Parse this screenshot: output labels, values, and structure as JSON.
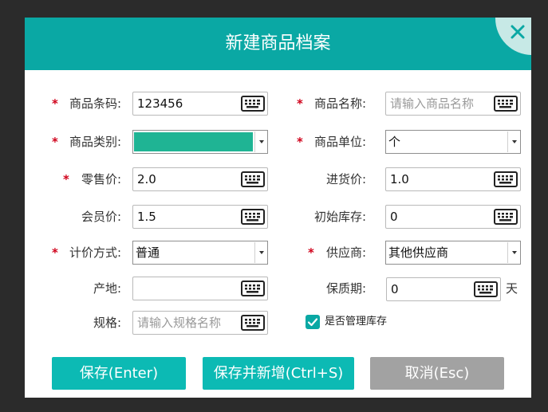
{
  "dialog": {
    "title": "新建商品档案",
    "close_icon": "close-icon",
    "accent_color": "#0aa8a4"
  },
  "required_mark": "*",
  "form": {
    "barcode": {
      "label": "商品条码:",
      "value": "123456",
      "required": true
    },
    "name": {
      "label": "商品名称:",
      "placeholder": "请输入商品名称",
      "required": true
    },
    "category": {
      "label": "商品类别:",
      "selected_color": "#1fb494",
      "required": true
    },
    "unit": {
      "label": "商品单位:",
      "value": "个",
      "required": true
    },
    "retail": {
      "label": "零售价:",
      "value": "2.0",
      "required": true
    },
    "purchase": {
      "label": "进货价:",
      "value": "1.0",
      "required": false
    },
    "member": {
      "label": "会员价:",
      "value": "1.5",
      "required": false
    },
    "stock": {
      "label": "初始库存:",
      "value": "0",
      "required": false
    },
    "pricing": {
      "label": "计价方式:",
      "value": "普通",
      "required": true
    },
    "supplier": {
      "label": "供应商:",
      "value": "其他供应商",
      "required": true
    },
    "origin": {
      "label": "产地:",
      "value": "",
      "required": false
    },
    "shelf": {
      "label": "保质期:",
      "value": "0",
      "unit": "天",
      "required": false
    },
    "spec": {
      "label": "规格:",
      "placeholder": "请输入规格名称",
      "required": false
    },
    "manage_stock": {
      "label": "是否管理库存",
      "checked": true
    }
  },
  "buttons": {
    "save": "保存(Enter)",
    "save_new": "保存并新增(Ctrl+S)",
    "cancel": "取消(Esc)",
    "save_color": "#0cbab4",
    "cancel_color": "#a2a2a2"
  }
}
